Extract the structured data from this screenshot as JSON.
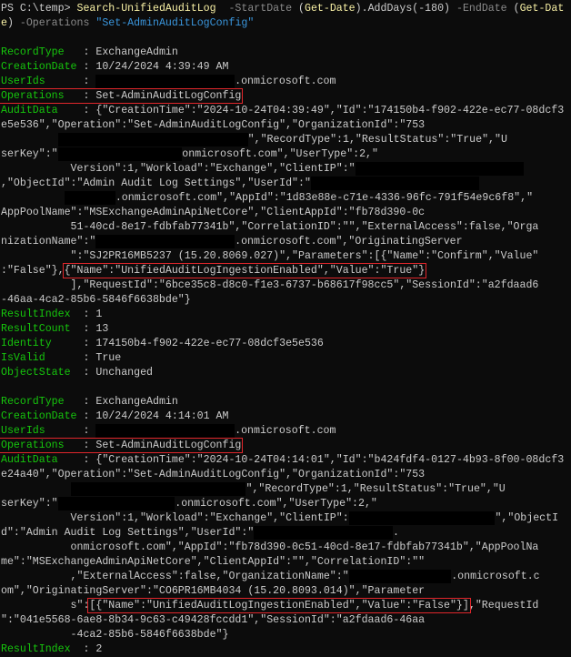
{
  "window": {
    "type": "PowerShell terminal"
  },
  "colors": {
    "background": "#0c0c0c",
    "text": "#cccccc",
    "property": "#16c60c",
    "cmdlet": "#f9f1a5",
    "parameter": "#8a8a8a",
    "string": "#3a96dd",
    "highlight": "#e0262b"
  },
  "lines": [
    [
      [
        "PS C:\\temp> ",
        "w"
      ],
      [
        "Search-UnifiedAuditLog",
        "y"
      ],
      [
        "  -StartDate ",
        "m"
      ],
      [
        "(",
        "w"
      ],
      [
        "Get-Date",
        "y"
      ],
      [
        ").AddDays(-180) ",
        "w"
      ],
      [
        "-EndDate ",
        "m"
      ],
      [
        "(",
        "w"
      ],
      [
        "Get-Dat",
        "y"
      ]
    ],
    [
      [
        "e",
        "y"
      ],
      [
        ") ",
        "w"
      ],
      [
        "-Operations ",
        "m"
      ],
      [
        "\"Set-AdminAuditLogConfig\"",
        "b"
      ]
    ],
    [],
    [
      [
        "RecordType   ",
        "g"
      ],
      [
        ": ExchangeAdmin",
        "w"
      ]
    ],
    [
      [
        "CreationDate ",
        "g"
      ],
      [
        ": 10/24/2024 4:39:49 AM",
        "w"
      ]
    ],
    [
      [
        "UserIds      ",
        "g"
      ],
      [
        ": ",
        "w"
      ],
      {
        "redact": 19
      },
      [
        ".onmicrosoft.com",
        "w"
      ]
    ],
    [
      {
        "box": [
          [
            "Operations   ",
            "g"
          ],
          [
            ": Set-AdminAuditLogConfig",
            "w"
          ]
        ]
      }
    ],
    [
      [
        "AuditData    ",
        "g"
      ],
      [
        ": {\"CreationTime\":\"2024-10-24T04:39:49\",\"Id\":\"174150b4-f902-422e-ec77-08dcf3",
        "w"
      ]
    ],
    [
      [
        "e5e536\",\"Operation\":\"Set-AdminAuditLogConfig\",\"OrganizationId\":\"753",
        "w"
      ]
    ],
    [
      [
        "         ",
        "w"
      ],
      {
        "redact": 26
      },
      [
        "\",\"RecordType\":1,\"ResultStatus\":\"True\",\"U",
        "w"
      ]
    ],
    [
      [
        "serKey\":\"",
        "w"
      ],
      {
        "redact": 17
      },
      [
        "onmicrosoft.com\",\"UserType\":2,\"",
        "w"
      ]
    ],
    [
      [
        "           Version\":1,\"Workload\":\"Exchange\",\"ClientIP\":\"",
        "w"
      ],
      {
        "redact": 23
      }
    ],
    [
      [
        ",\"ObjectId\":\"Admin Audit Log Settings\",\"UserId\":\"",
        "w"
      ],
      {
        "redact": 23
      }
    ],
    [
      [
        "          ",
        "w"
      ],
      {
        "redact": 7
      },
      [
        ".onmicrosoft.com\",\"AppId\":\"1d83e88e-c71e-4336-96fc-791f54e9c6f8\",\"",
        "w"
      ]
    ],
    [
      [
        "AppPoolName\":\"MSExchangeAdminApiNetCore\",\"ClientAppId\":\"fb78d390-0c",
        "w"
      ]
    ],
    [
      [
        "           51-40cd-8e17-fdbfab77341b\",\"CorrelationID\":\"\",\"ExternalAccess\":false,\"Orga",
        "w"
      ]
    ],
    [
      [
        "nizationName\":\"",
        "w"
      ],
      {
        "redact": 19
      },
      [
        ".onmicrosoft.com\",\"OriginatingServer",
        "w"
      ]
    ],
    [
      [
        "           \":\"SJ2PR16MB5237 (15.20.8069.027)\",\"Parameters\":[{\"Name\":\"Confirm\",\"Value\"",
        "w"
      ]
    ],
    [
      [
        ":\"False\"},",
        "w"
      ],
      {
        "box": [
          [
            "{\"Name\":\"UnifiedAuditLogIngestionEnabled\",\"Value\":\"True\"}",
            "w"
          ]
        ]
      }
    ],
    [
      [
        "           ],\"RequestId\":\"6bce35c8-d8c0-f1e3-6737-b68617f98cc5\",\"SessionId\":\"a2fdaad6",
        "w"
      ]
    ],
    [
      [
        "-46aa-4ca2-85b6-5846f6638bde\"}",
        "w"
      ]
    ],
    [
      [
        "ResultIndex  ",
        "g"
      ],
      [
        ": 1",
        "w"
      ]
    ],
    [
      [
        "ResultCount  ",
        "g"
      ],
      [
        ": 13",
        "w"
      ]
    ],
    [
      [
        "Identity     ",
        "g"
      ],
      [
        ": 174150b4-f902-422e-ec77-08dcf3e5e536",
        "w"
      ]
    ],
    [
      [
        "IsValid      ",
        "g"
      ],
      [
        ": True",
        "w"
      ]
    ],
    [
      [
        "ObjectState  ",
        "g"
      ],
      [
        ": Unchanged",
        "w"
      ]
    ],
    [],
    [
      [
        "RecordType   ",
        "g"
      ],
      [
        ": ExchangeAdmin",
        "w"
      ]
    ],
    [
      [
        "CreationDate ",
        "g"
      ],
      [
        ": 10/24/2024 4:14:01 AM",
        "w"
      ]
    ],
    [
      [
        "UserIds      ",
        "g"
      ],
      [
        ": ",
        "w"
      ],
      {
        "redact": 19
      },
      [
        ".onmicrosoft.com",
        "w"
      ]
    ],
    [
      {
        "box": [
          [
            "Operations   ",
            "g"
          ],
          [
            ": Set-AdminAuditLogConfig",
            "w"
          ]
        ]
      }
    ],
    [
      [
        "AuditData    ",
        "g"
      ],
      [
        ": {\"CreationTime\":\"2024-10-24T04:14:01\",\"Id\":\"b424fdf4-0127-4b93-8f00-08dcf3",
        "w"
      ]
    ],
    [
      [
        "e24a40\",\"Operation\":\"Set-AdminAuditLogConfig\",\"OrganizationId\":\"753",
        "w"
      ]
    ],
    [
      [
        "           ",
        "w"
      ],
      {
        "redact": 24
      },
      [
        "\",\"RecordType\":1,\"ResultStatus\":\"True\",\"U",
        "w"
      ]
    ],
    [
      [
        "serKey\":\"",
        "w"
      ],
      {
        "redact": 16
      },
      [
        ".onmicrosoft.com\",\"UserType\":2,\"",
        "w"
      ]
    ],
    [
      [
        "           Version\":1,\"Workload\":\"Exchange\",\"ClientIP\":",
        "w"
      ],
      {
        "redact": 20
      },
      [
        "\",\"ObjectI",
        "w"
      ]
    ],
    [
      [
        "d\":\"Admin Audit Log Settings\",\"UserId\":\"",
        "w"
      ],
      {
        "redact": 19
      },
      [
        ".",
        "w"
      ]
    ],
    [
      [
        "           onmicrosoft.com\",\"AppId\":\"fb78d390-0c51-40cd-8e17-fdbfab77341b\",\"AppPoolNa",
        "w"
      ]
    ],
    [
      [
        "me\":\"MSExchangeAdminApiNetCore\",\"ClientAppId\":\"\",\"CorrelationID\":\"\"",
        "w"
      ]
    ],
    [
      [
        "           ,\"ExternalAccess\":false,\"OrganizationName\":\"",
        "w"
      ],
      {
        "redact": 14
      },
      [
        ".onmicrosoft.c",
        "w"
      ]
    ],
    [
      [
        "om\",\"OriginatingServer\":\"CO6PR16MB4034 (15.20.8093.014)\",\"Parameter",
        "w"
      ]
    ],
    [
      [
        "           s\":",
        "w"
      ],
      {
        "box": [
          [
            "[{\"Name\":\"UnifiedAuditLogIngestionEnabled\",\"Value\":\"False\"}]",
            "w"
          ]
        ]
      },
      [
        ",\"RequestId",
        "w"
      ]
    ],
    [
      [
        "\":\"041e5568-6ae8-8b34-9c63-c49428fccdd1\",\"SessionId\":\"a2fdaad6-46aa",
        "w"
      ]
    ],
    [
      [
        "           -4ca2-85b6-5846f6638bde\"}",
        "w"
      ]
    ],
    [
      [
        "ResultIndex  ",
        "g"
      ],
      [
        ": 2",
        "w"
      ]
    ]
  ]
}
